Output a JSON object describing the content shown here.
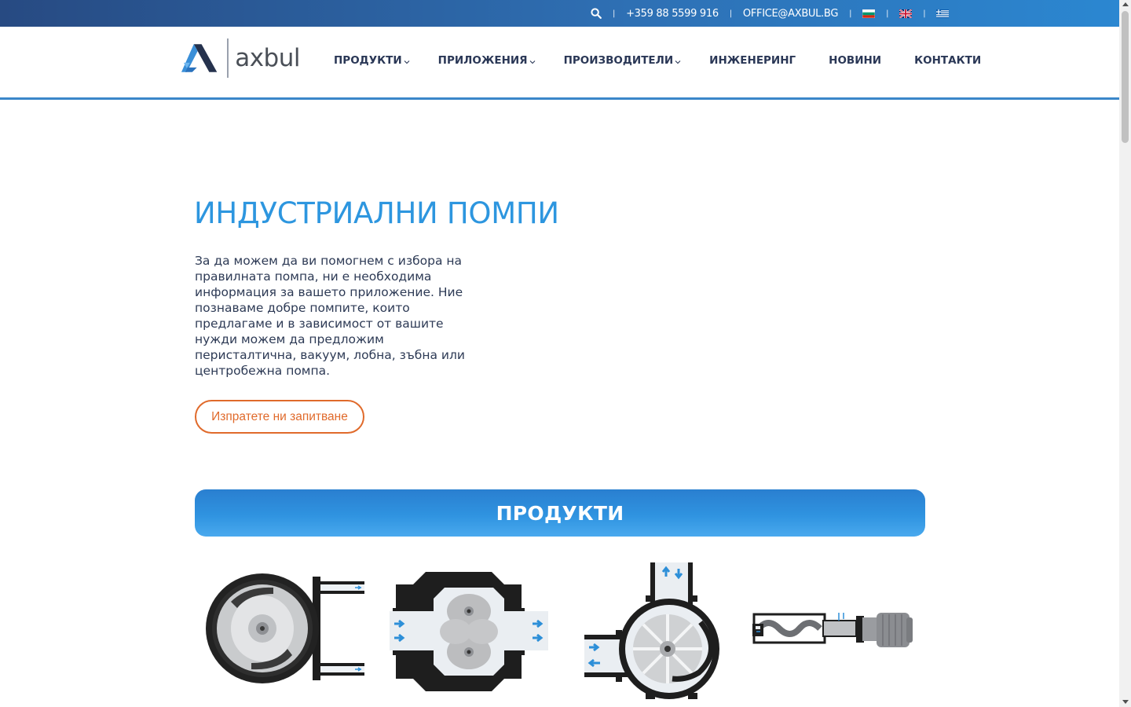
{
  "topbar": {
    "phone": "+359 88 5599 916",
    "email": "OFFICE@AXBUL.BG",
    "separator": "|",
    "flags": [
      "bulgarian-flag-icon",
      "uk-flag-icon",
      "greek-flag-icon"
    ]
  },
  "logo": {
    "text": "axbul"
  },
  "nav": {
    "items": [
      {
        "label": "ПРОДУКТИ",
        "dropdown": true
      },
      {
        "label": "ПРИЛОЖЕНИЯ",
        "dropdown": true
      },
      {
        "label": "ПРОИЗВОДИТЕЛИ",
        "dropdown": true
      },
      {
        "label": "ИНЖЕНЕРИНГ",
        "dropdown": false
      },
      {
        "label": "НОВИНИ",
        "dropdown": false
      },
      {
        "label": "КОНТАКТИ",
        "dropdown": false
      }
    ]
  },
  "hero": {
    "title": "ИНДУСТРИАЛНИ ПОМПИ",
    "text": "За да можем да ви помогнем с избора на правилната помпа, ни е необходима информация за вашето приложение. Ние познаваме добре помпите, които предлагаме и в зависимост от вашите нужди можем да предложим перисталтична, вакуум, лобна, зъбна или центробежна помпа.",
    "cta_label": "Изпратете ни запитване"
  },
  "products": {
    "title": "ПРОДУКТИ",
    "items": [
      "peristaltic-pump-icon",
      "lobe-pump-icon",
      "vane-pump-icon",
      "progressive-cavity-pump-icon"
    ]
  },
  "colors": {
    "accent": "#2d96df",
    "cta": "#e06a2b",
    "topbar_start": "#274a82",
    "topbar_end": "#2b87d1",
    "text": "#2d3a55"
  }
}
